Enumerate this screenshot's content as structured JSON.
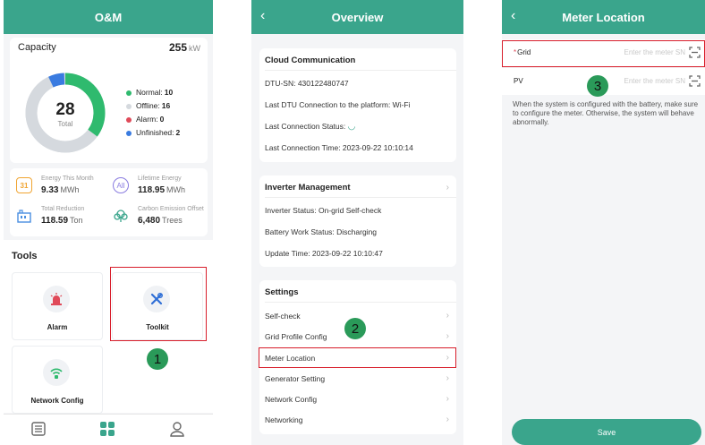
{
  "colors": {
    "accent": "#3aa58c",
    "normal": "#2fba6e",
    "offline": "#d5d9de",
    "alarm": "#e04a59",
    "unfinished": "#3a7be0",
    "callout": "#d81e2b",
    "badge": "#2a9a59"
  },
  "screen1": {
    "title": "O&M",
    "capacity": {
      "label": "Capacity",
      "value": "255",
      "unit": "kW"
    },
    "donut": {
      "total": "28",
      "total_label": "Total"
    },
    "legend": [
      {
        "label": "Normal:",
        "value": "10",
        "color": "#2fba6e"
      },
      {
        "label": "Offline:",
        "value": "16",
        "color": "#d5d9de"
      },
      {
        "label": "Alarm:",
        "value": "0",
        "color": "#e04a59"
      },
      {
        "label": "Unfinished:",
        "value": "2",
        "color": "#3a7be0"
      }
    ],
    "stats": [
      {
        "label": "Energy This Month",
        "value": "9.33",
        "unit": "MWh",
        "icon": "calendar-icon",
        "glyph": "31"
      },
      {
        "label": "Lifetime Energy",
        "value": "118.95",
        "unit": "MWh",
        "icon": "all-icon",
        "glyph": "All"
      },
      {
        "label": "Total Reduction",
        "value": "118.59",
        "unit": "Ton",
        "icon": "factory-icon",
        "glyph": ""
      },
      {
        "label": "Carbon Emission Offset",
        "value": "6,480",
        "unit": "Trees",
        "icon": "tree-icon",
        "glyph": ""
      }
    ],
    "tools_title": "Tools",
    "tools": [
      {
        "label": "Alarm",
        "icon": "alarm-siren-icon"
      },
      {
        "label": "Toolkit",
        "icon": "toolkit-icon"
      },
      {
        "label": "Network Config",
        "icon": "wifi-icon"
      }
    ],
    "nav": [
      {
        "icon": "list-icon",
        "active": false
      },
      {
        "icon": "grid-icon",
        "active": true
      },
      {
        "icon": "user-icon",
        "active": false
      }
    ],
    "step": "1"
  },
  "screen2": {
    "title": "Overview",
    "cloud": {
      "title": "Cloud Communication",
      "lines": [
        "DTU-SN:  430122480747",
        "Last DTU Connection to the platform:  Wi-Fi",
        "Last Connection Status:",
        "Last Connection Time:  2023-09-22 10:10:14"
      ]
    },
    "inverter": {
      "title": "Inverter Management",
      "lines": [
        "Inverter Status:  On-grid Self-check",
        "Battery Work Status:  Discharging",
        "Update Time:  2023-09-22 10:10:47"
      ]
    },
    "settings": {
      "title": "Settings",
      "items": [
        "Self-check",
        "Grid Profile Config",
        "Meter Location",
        "Generator Setting",
        "Network Config",
        "Networking"
      ]
    },
    "step": "2"
  },
  "screen3": {
    "title": "Meter Location",
    "grid_label": "Grid",
    "pv_label": "PV",
    "placeholder": "Enter the meter SN",
    "note": "When the system is configured with the battery, make sure to configure the meter. Otherwise, the system will behave abnormally.",
    "save_label": "Save",
    "step": "3"
  }
}
